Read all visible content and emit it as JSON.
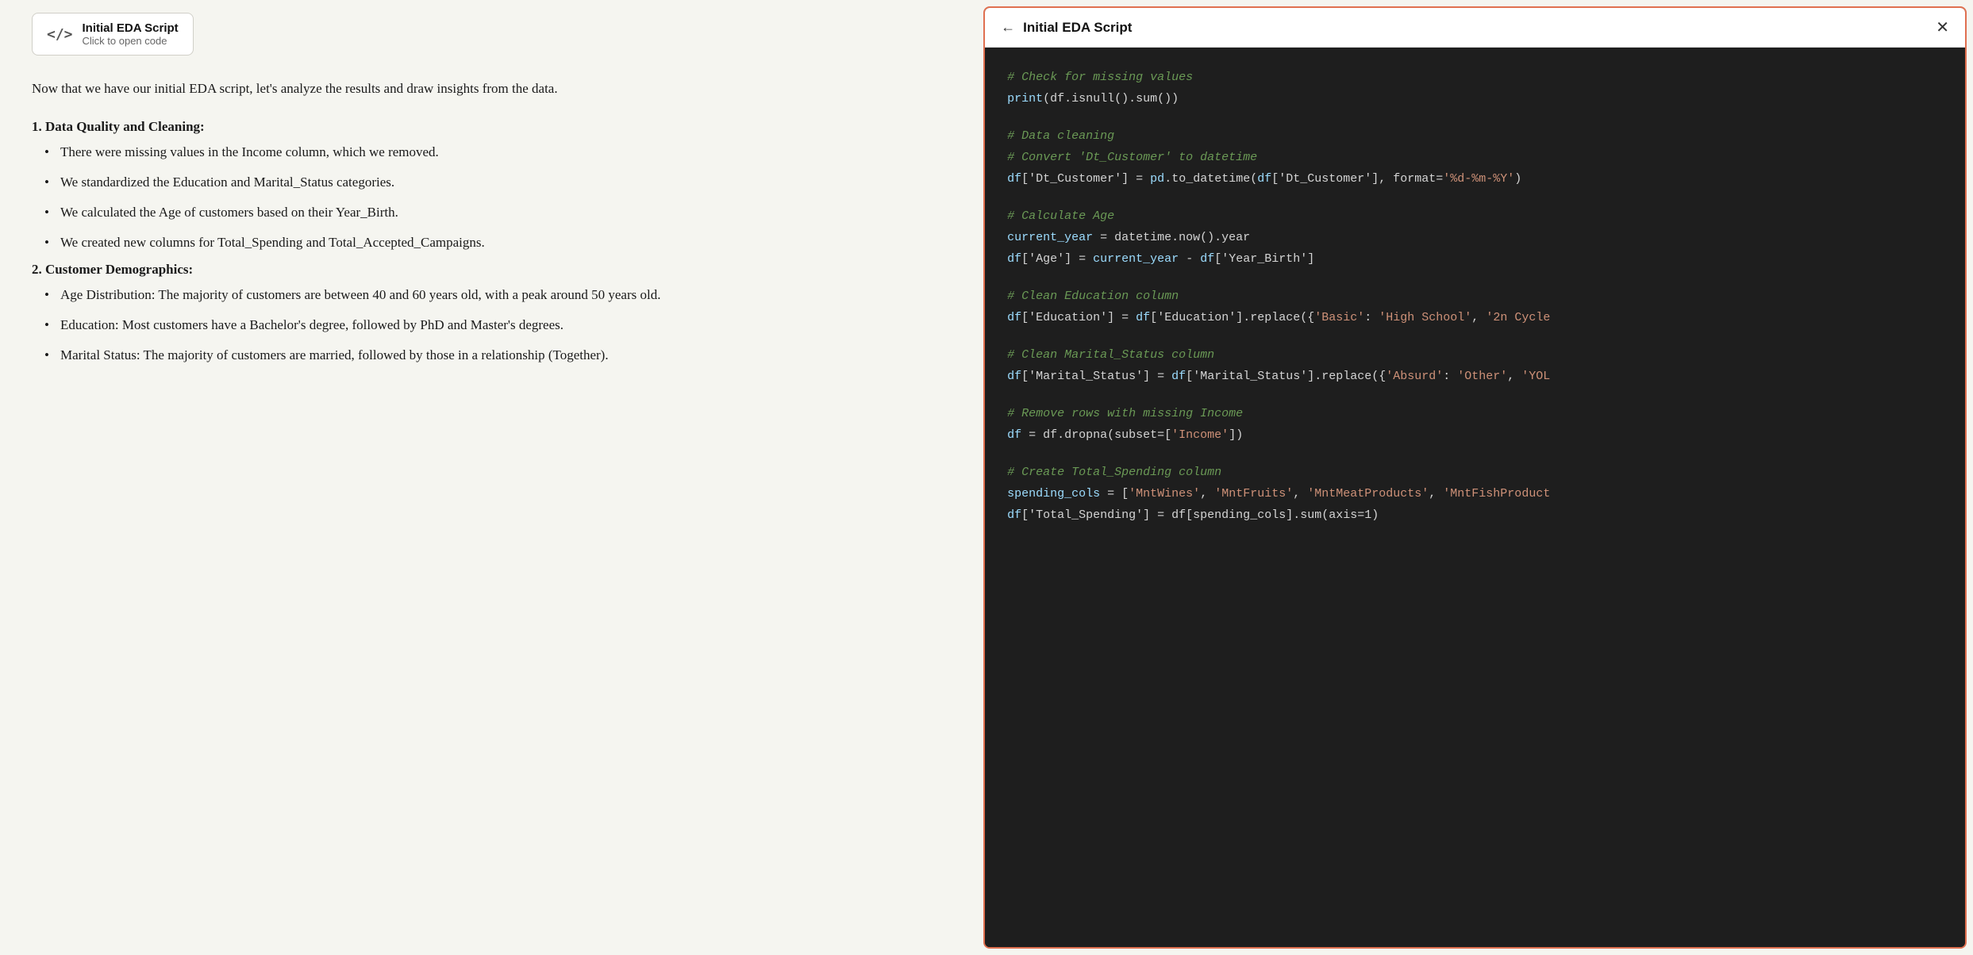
{
  "left": {
    "card": {
      "icon": "</>",
      "title": "Initial EDA Script",
      "subtitle": "Click to open code"
    },
    "intro": "Now that we have our initial EDA script, let's analyze the results and draw insights from the data.",
    "sections": [
      {
        "heading": "1. Data Quality and Cleaning:",
        "bullets": [
          "There were missing values in the Income column, which we removed.",
          "We standardized the Education and Marital_Status categories.",
          "We calculated the Age of customers based on their Year_Birth.",
          "We created new columns for Total_Spending and Total_Accepted_Campaigns."
        ]
      },
      {
        "heading": "2. Customer Demographics:",
        "bullets": [
          "Age Distribution: The majority of customers are between 40 and 60 years old, with a peak around 50 years old.",
          "Education: Most customers have a Bachelor's degree, followed by PhD and Master's degrees.",
          "Marital Status: The majority of customers are married, followed by those in a relationship (Together)."
        ]
      }
    ]
  },
  "right": {
    "header": {
      "back_label": "←",
      "title": "Initial EDA Script",
      "close_label": "✕"
    },
    "code_blocks": [
      {
        "type": "comment",
        "text": "# Check for missing values"
      },
      {
        "type": "code",
        "text": "print(df.isnull().sum())"
      },
      {
        "type": "empty"
      },
      {
        "type": "comment",
        "text": "# Data cleaning"
      },
      {
        "type": "comment",
        "text": "# Convert 'Dt_Customer' to datetime"
      },
      {
        "type": "code",
        "text": "df['Dt_Customer'] = pd.to_datetime(df['Dt_Customer'], format='%d-%m-%Y')"
      },
      {
        "type": "empty"
      },
      {
        "type": "comment",
        "text": "# Calculate Age"
      },
      {
        "type": "code",
        "text": "current_year = datetime.now().year"
      },
      {
        "type": "code",
        "text": "df['Age'] = current_year - df['Year_Birth']"
      },
      {
        "type": "empty"
      },
      {
        "type": "comment",
        "text": "# Clean Education column"
      },
      {
        "type": "code",
        "text": "df['Education'] = df['Education'].replace({'Basic': 'High School', '2n Cycle"
      },
      {
        "type": "empty"
      },
      {
        "type": "comment",
        "text": "# Clean Marital_Status column"
      },
      {
        "type": "code",
        "text": "df['Marital_Status'] = df['Marital_Status'].replace({'Absurd': 'Other', 'YOL"
      },
      {
        "type": "empty"
      },
      {
        "type": "comment",
        "text": "# Remove rows with missing Income"
      },
      {
        "type": "code",
        "text": "df = df.dropna(subset=['Income'])"
      },
      {
        "type": "empty"
      },
      {
        "type": "comment",
        "text": "# Create Total_Spending column"
      },
      {
        "type": "code",
        "text": "spending_cols = ['MntWines', 'MntFruits', 'MntMeatProducts', 'MntFishProduct"
      },
      {
        "type": "code",
        "text": "df['Total_Spending'] = df[spending_cols].sum(axis=1)"
      }
    ]
  }
}
